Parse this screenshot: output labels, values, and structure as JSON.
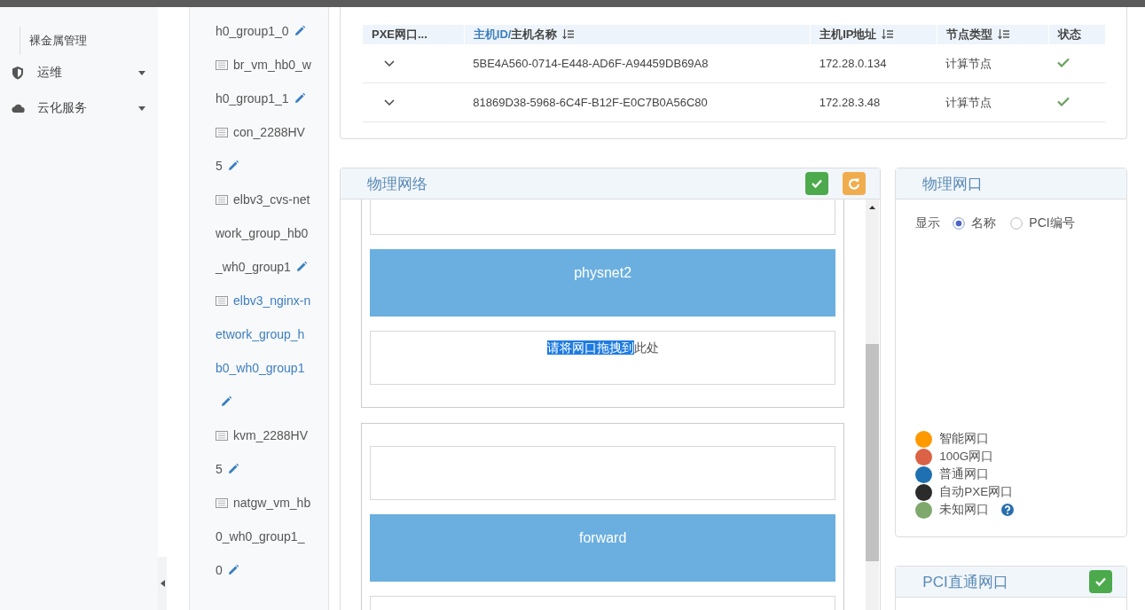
{
  "sidebar": {
    "items": [
      {
        "label": "裸金属管理",
        "kind": "subitem"
      },
      {
        "label": "运维",
        "kind": "group",
        "expanded": false
      },
      {
        "label": "云化服务",
        "kind": "group",
        "expanded": false
      }
    ]
  },
  "tree": {
    "items": [
      {
        "label": "h0_group1_0",
        "kind": "continued",
        "selected": false
      },
      {
        "label": "br_vm_hb0_wh0_group1_1",
        "kind": "node",
        "selected": false
      },
      {
        "label": "con_2288HV5",
        "kind": "node",
        "selected": false
      },
      {
        "label": "elbv3_cvs-network_group_hb0_wh0_group1",
        "kind": "node",
        "selected": false
      },
      {
        "label": "elbv3_nginx-network_group_hb0_wh0_group1",
        "kind": "node",
        "selected": true
      },
      {
        "label": "kvm_2288HV5",
        "kind": "node",
        "selected": false
      },
      {
        "label": "natgw_vm_hb0_wh0_group1_0",
        "kind": "node",
        "selected": false
      }
    ]
  },
  "host_table": {
    "columns": [
      {
        "parts": [
          {
            "text": "PXE网口...",
            "active": false
          }
        ],
        "sortable": false
      },
      {
        "parts": [
          {
            "text": "主机ID/",
            "active": true
          },
          {
            "text": "主机名称",
            "active": false
          }
        ],
        "sortable": true
      },
      {
        "parts": [
          {
            "text": "主机IP地址",
            "active": false
          }
        ],
        "sortable": true
      },
      {
        "parts": [
          {
            "text": "节点类型",
            "active": false
          }
        ],
        "sortable": true
      },
      {
        "parts": [
          {
            "text": "状态",
            "active": false
          }
        ],
        "sortable": false
      }
    ],
    "rows": [
      {
        "expanded": false,
        "host": "5BE4A560-0714-E448-AD6F-A94459DB69A8",
        "ip": "172.28.0.134",
        "type": "计算节点",
        "status_ok": true
      },
      {
        "expanded": false,
        "host": "81869D38-5968-6C4F-B12F-E0C7B0A56C80",
        "ip": "172.28.3.48",
        "type": "计算节点",
        "status_ok": true
      }
    ]
  },
  "physical_network": {
    "title": "物理网络",
    "buttons": [
      {
        "kind": "confirm"
      },
      {
        "kind": "refresh"
      }
    ],
    "groups": [
      {
        "items": [
          {
            "kind": "drop"
          },
          {
            "kind": "net",
            "name": "physnet2"
          },
          {
            "kind": "drop",
            "hint_selected": "请将网口拖拽到",
            "hint": "此处"
          }
        ]
      },
      {
        "items": [
          {
            "kind": "drop"
          },
          {
            "kind": "net",
            "name": "forward"
          },
          {
            "kind": "drop"
          }
        ]
      }
    ]
  },
  "ports": {
    "title": "物理网口",
    "display_label": "显示",
    "options": [
      {
        "label": "名称",
        "selected": true
      },
      {
        "label": "PCI编号",
        "selected": false
      }
    ],
    "legend": [
      {
        "label": "智能网口",
        "color": "#ff9900",
        "help": false
      },
      {
        "label": "100G网口",
        "color": "#dc6245",
        "help": false
      },
      {
        "label": "普通网口",
        "color": "#1f70b0",
        "help": false
      },
      {
        "label": "自动PXE网口",
        "color": "#2b2b2b",
        "help": false
      },
      {
        "label": "未知网口",
        "color": "#7fa86c",
        "help": true
      }
    ]
  },
  "pci": {
    "title": "PCI直通网口",
    "buttons": [
      {
        "kind": "confirm"
      }
    ]
  }
}
